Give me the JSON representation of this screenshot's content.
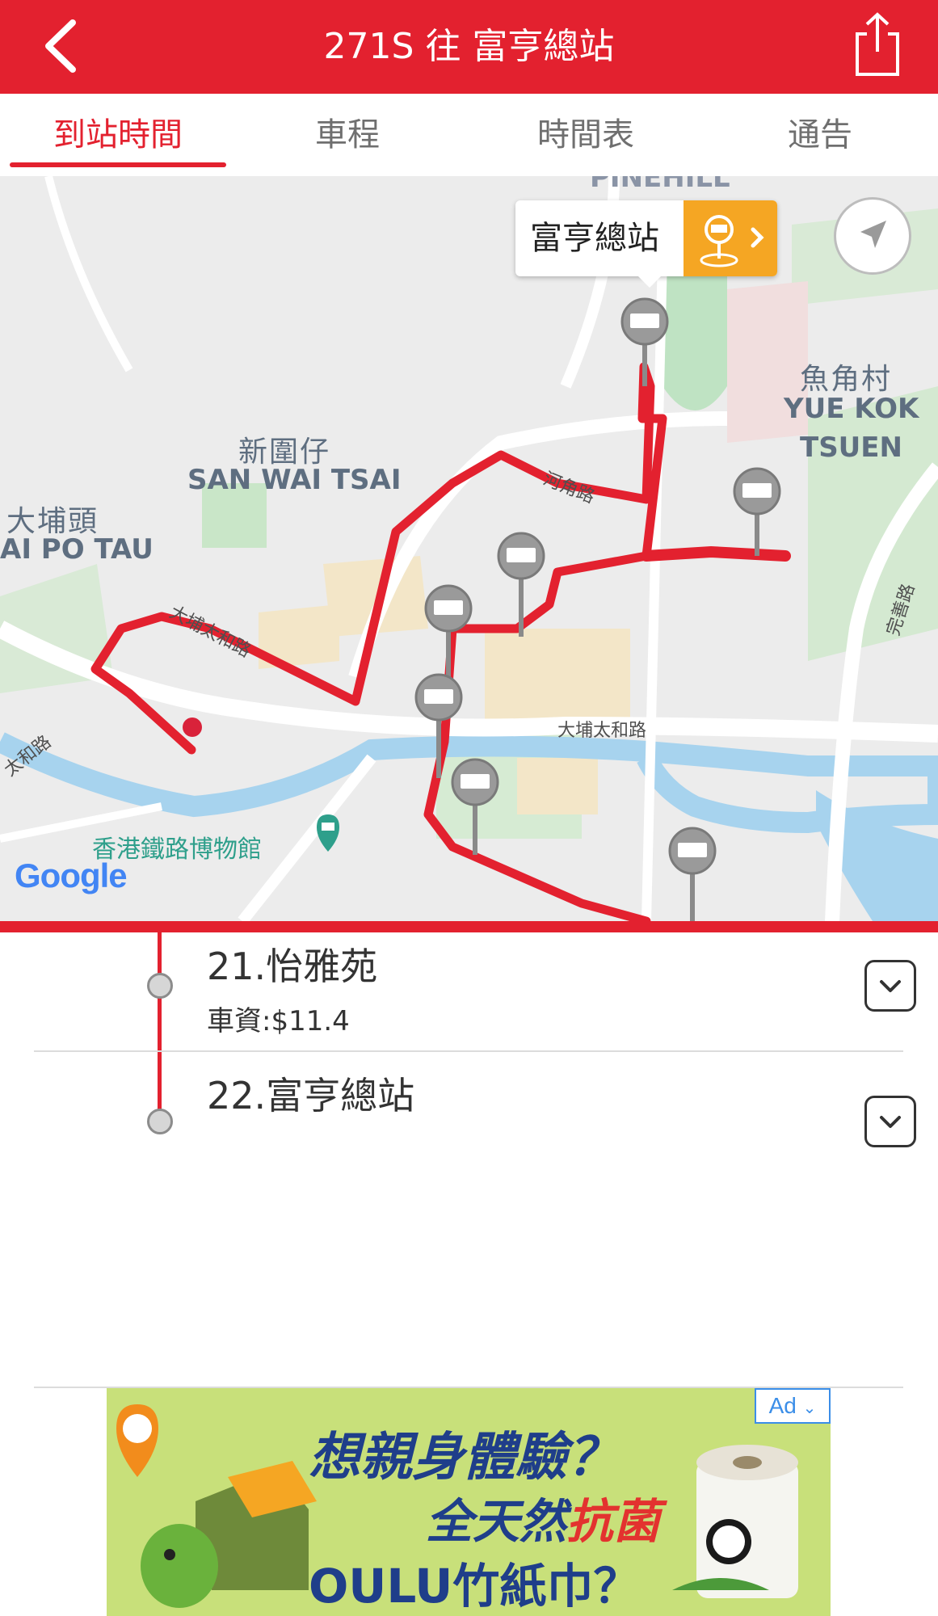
{
  "header": {
    "title": "271S 往 富亨總站"
  },
  "tabs": [
    {
      "label": "到站時間",
      "active": true
    },
    {
      "label": "車程",
      "active": false
    },
    {
      "label": "時間表",
      "active": false
    },
    {
      "label": "通告",
      "active": false
    }
  ],
  "map": {
    "callout_stop": "富亨總站",
    "labels": {
      "pinehill": "PINEHILL",
      "san_wai_tsai_zh": "新圍仔",
      "san_wai_tsai_en": "SAN WAI TSAI",
      "tai_po_tau_zh": "大埔頭",
      "tai_po_tau_en": "AI PO TAU",
      "yue_kok_zh": "魚角村",
      "yue_kok_en1": "YUE KOK",
      "yue_kok_en2": "TSUEN",
      "road_ho_kok": "河角路",
      "road_tai_po_tai_wo_1": "大埔太和路",
      "road_tai_po_tai_wo_2": "大埔太和路",
      "road_tai_wo_edge": "太和路",
      "road_wan_tau": "完善路",
      "museum": "香港鐵路博物館"
    },
    "attribution": "Google"
  },
  "stops": [
    {
      "name": "21.怡雅苑",
      "fare": "車資:$11.4"
    },
    {
      "name": "22.富亨總站",
      "fare": ""
    }
  ],
  "ad": {
    "tag": "Ad",
    "line1": "想親身體驗？",
    "line2a": "全天然",
    "line2b": "抗菌",
    "line3": "OULU竹紙巾？"
  },
  "colors": {
    "brand_red": "#e3212f",
    "callout_orange": "#f5a623"
  }
}
